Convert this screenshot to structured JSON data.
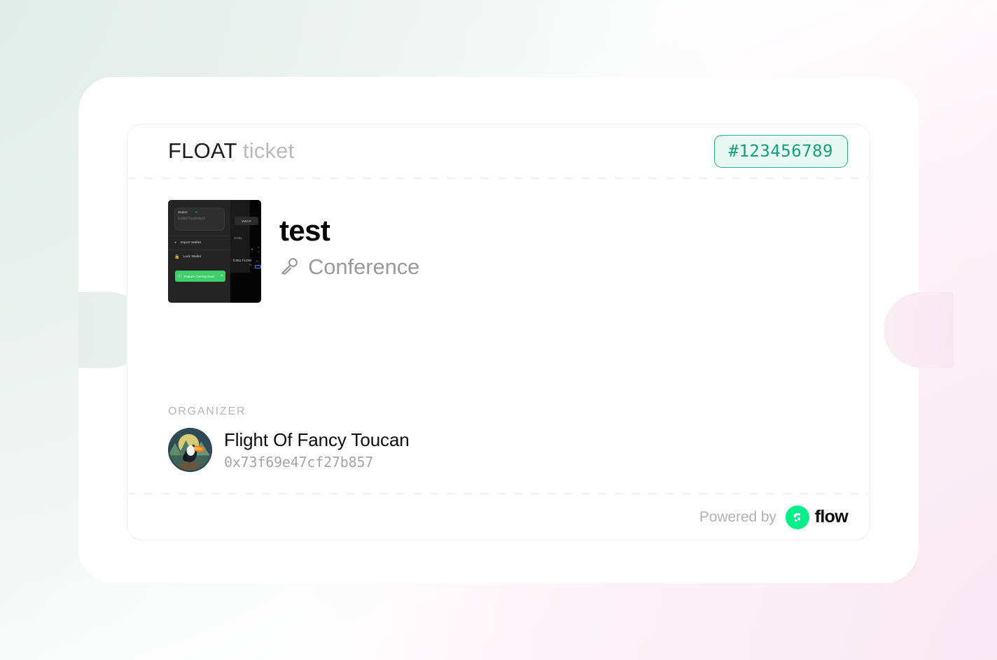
{
  "background": {
    "mint": "#e9f1ee",
    "pink": "#fbeef5",
    "card": "#ffffff"
  },
  "ticket": {
    "header": {
      "brand_strong": "FLOAT",
      "brand_dim": "ticket",
      "serial_badge": "#123456789",
      "badge_text_color": "#14a07c",
      "badge_bg_color": "#e9f8f2",
      "badge_border_color": "#23b38c"
    },
    "event": {
      "title": "test",
      "type_icon": "microphone-icon",
      "type": "Conference",
      "thumbnail": {
        "alt": "wallet-app-screenshot",
        "wallet_label": "Wallet",
        "wallet_plus": "+",
        "wallet_address": "0x9302754c69f0e57",
        "menu_items": [
          {
            "icon": "plus-icon",
            "glyph": "+",
            "label": "Import Wallet"
          },
          {
            "icon": "lock-icon",
            "glyph": "ὑ2",
            "label": "Lock Wallet"
          }
        ],
        "toast": {
          "icon": "info-icon",
          "label": "Feature Coming Soon",
          "close": "×",
          "color": "#3ecf6b"
        },
        "swap_button": "SWAP",
        "activity_label": "ctivity",
        "plus_glyph": "+",
        "balance": "0.001 FLOW",
        "balance_sub": "50",
        "edge_frag_1": "rt",
        "edge_frag_2": "a",
        "edge_frag_3": "H"
      }
    },
    "organizer": {
      "kicker": "ORGANIZER",
      "avatar_alt": "toucan-avatar",
      "name": "Flight Of Fancy Toucan",
      "address": "0x73f69e47cf27b857"
    },
    "footer": {
      "powered_by": "Powered by",
      "brand_word": "flow",
      "brand_color": "#00ef8b"
    }
  }
}
